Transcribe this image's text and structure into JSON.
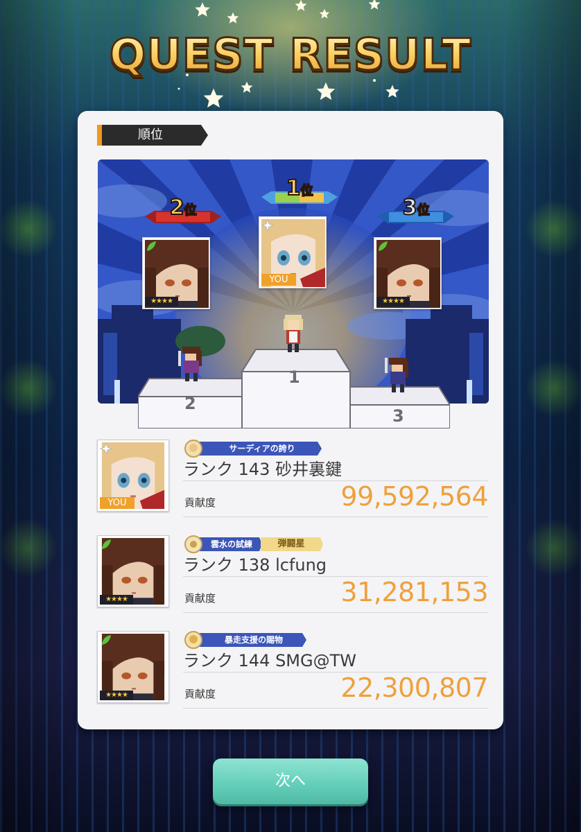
{
  "header": {
    "title": "QUEST RESULT"
  },
  "section": {
    "label": "順位"
  },
  "podium": {
    "first": {
      "rank_label": "1",
      "rank_suffix": "位",
      "podium_number": "1",
      "is_you": true
    },
    "second": {
      "rank_label": "2",
      "rank_suffix": "位",
      "podium_number": "2",
      "stars": "★★★★"
    },
    "third": {
      "rank_label": "3",
      "rank_suffix": "位",
      "podium_number": "3",
      "stars": "★★★★"
    },
    "you_label": "YOU"
  },
  "results": [
    {
      "title_badge": "サーディアの誇り",
      "name": "ランク 143 砂井裏鍵",
      "contrib_label": "貢献度",
      "score": "99,592,564",
      "you_label": "YOU"
    },
    {
      "title_badge": "雲水の試練",
      "title_badge_extra": "弾闘星",
      "name": "ランク 138 lcfung",
      "contrib_label": "貢献度",
      "score": "31,281,153",
      "stars": "★★★★"
    },
    {
      "title_badge": "暴走支援の賜物",
      "name": "ランク 144 SMG@TW",
      "contrib_label": "貢献度",
      "score": "22,300,807",
      "stars": "★★★★"
    }
  ],
  "footer": {
    "next_label": "次へ"
  },
  "colors": {
    "accent_orange": "#efa03c",
    "button_teal": "#62cdb8",
    "you_tag": "#f0a12a"
  }
}
